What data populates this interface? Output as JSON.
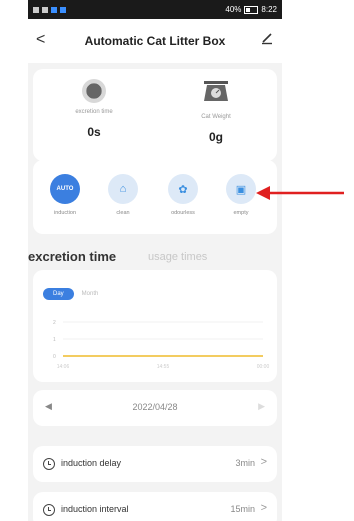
{
  "status_bar": {
    "battery_percent": "40%",
    "time": "8:22"
  },
  "header": {
    "title": "Automatic Cat Litter Box"
  },
  "stats": {
    "excretion_time": {
      "label": "excretion time",
      "value": "0s"
    },
    "cat_weight": {
      "label": "Cat Weight",
      "value": "0g"
    }
  },
  "modes": [
    {
      "icon_text": "AUTO",
      "label": "induction",
      "icon": "auto-icon"
    },
    {
      "icon_text": "⌂",
      "label": "clean",
      "icon": "clean-icon"
    },
    {
      "icon_text": "✿",
      "label": "odourless",
      "icon": "odourless-icon"
    },
    {
      "icon_text": "▣",
      "label": "empty",
      "icon": "empty-icon"
    }
  ],
  "section": {
    "title": "excretion time",
    "alt_tab": "usage times"
  },
  "chart": {
    "toggle_day": "Day",
    "toggle_month": "Month"
  },
  "chart_data": {
    "type": "line",
    "y_ticks": [
      "2",
      "1",
      "0"
    ],
    "x_ticks": [
      "14:06",
      "14:55",
      "00:00"
    ],
    "series": [
      {
        "values": [
          0,
          0,
          0
        ]
      }
    ],
    "ylim": [
      0,
      2
    ]
  },
  "date_selector": {
    "date": "2022/04/28"
  },
  "settings": [
    {
      "name": "induction delay",
      "value": "3min"
    },
    {
      "name": "induction interval",
      "value": "15min"
    }
  ],
  "colors": {
    "accent": "#3b7fe0",
    "annotation_arrow": "#e02020",
    "line": "#f3cc60"
  }
}
